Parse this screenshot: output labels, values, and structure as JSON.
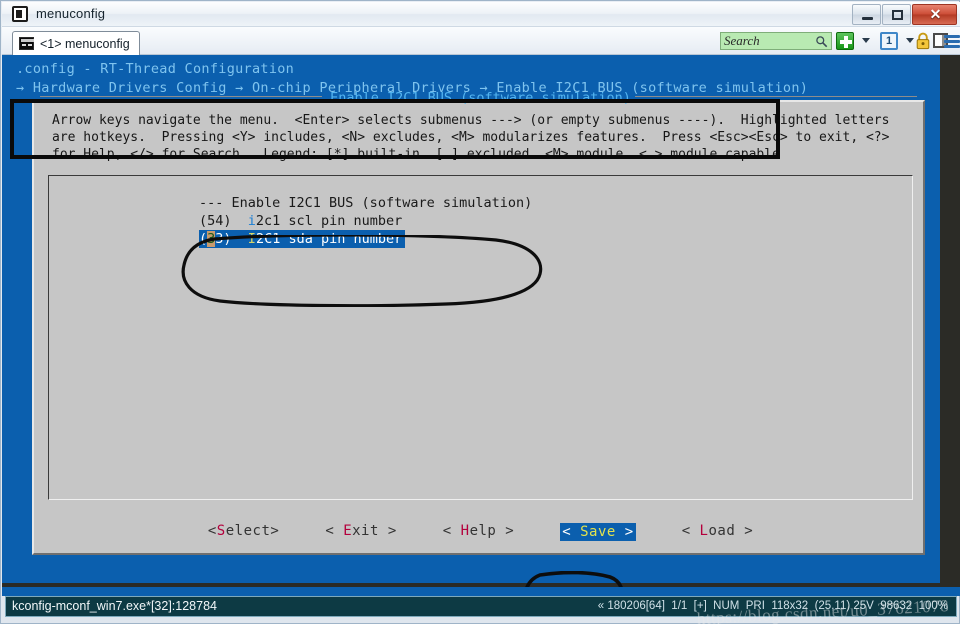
{
  "window": {
    "title": "menuconfig",
    "icon": "terminal-window-icon",
    "buttons": {
      "minimize": "minimize-icon",
      "maximize": "maximize-icon",
      "close": "✕"
    }
  },
  "toolbar": {
    "tab": {
      "label": "<1> menuconfig",
      "icon": "console-tab-icon"
    },
    "search": {
      "placeholder": "Search",
      "value": "",
      "icon": "search-icon"
    },
    "new_tab_label": "+",
    "session_label": "1",
    "icons": [
      "add-icon",
      "chevron-down-icon",
      "session-icon",
      "chevron-down-icon",
      "lock-icon",
      "panel-icon",
      "menu-icon"
    ]
  },
  "ncurses": {
    "breadcrumb_line1": ".config - RT-Thread Configuration",
    "breadcrumb_line2": "→ Hardware Drivers Config → On-chip Peripheral Drivers → Enable I2C1 BUS (software simulation)"
  },
  "dialog": {
    "title": "Enable I2C1 BUS (software simulation)",
    "help_lines": [
      "Arrow keys navigate the menu.  <Enter> selects submenus ---> (or empty submenus ----).  Highlighted letters",
      "are hotkeys.  Pressing <Y> includes, <N> excludes, <M> modularizes features.  Press <Esc><Esc> to exit, <?>",
      "for Help, </> for Search.  Legend: [*] built-in  [ ] excluded  <M> module  < > module capable"
    ],
    "list": [
      {
        "prefix": "--- ",
        "hotkey": "",
        "text": "Enable I2C1 BUS (software simulation)",
        "selected": false
      },
      {
        "prefix": "(54)  ",
        "hotkey": "i",
        "text": "2c1 scl pin number",
        "selected": false
      },
      {
        "prefix": "(33)  ",
        "hotkey": "I",
        "text": "2C1 sda pin number",
        "selected": true,
        "cursor_char": "3"
      }
    ],
    "buttons": [
      {
        "open": "<",
        "hotkey": "S",
        "rest": "elect",
        "close": ">",
        "spaced": false,
        "selected": false
      },
      {
        "open": "<",
        "hotkey": "E",
        "rest": "xit",
        "close": ">",
        "spaced": true,
        "selected": false
      },
      {
        "open": "<",
        "hotkey": "H",
        "rest": "elp",
        "close": ">",
        "spaced": true,
        "selected": false
      },
      {
        "open": "<",
        "hotkey": "S",
        "rest": "ave",
        "close": ">",
        "spaced": true,
        "selected": true
      },
      {
        "open": "<",
        "hotkey": "L",
        "rest": "oad",
        "close": ">",
        "spaced": true,
        "selected": false
      }
    ]
  },
  "statusbar": {
    "left": "kconfig-mconf_win7.exe*[32]:128784",
    "right": "« 180206[64]  1/1  [+]  NUM  PRI  118x32  (25,11) 25V  98632  100%"
  },
  "watermark": "https://blog.csdn.net/u0_37621078",
  "colors": {
    "ncurses_blue": "#0b5fae",
    "dialog_gray": "#c6c6c6",
    "terminal_dark": "#2b2b26",
    "cyan_title": "#53b4f0",
    "hotkey_red": "#b4003c",
    "cursor_tan": "#c79a6e",
    "status_teal": "#0d3a44"
  }
}
